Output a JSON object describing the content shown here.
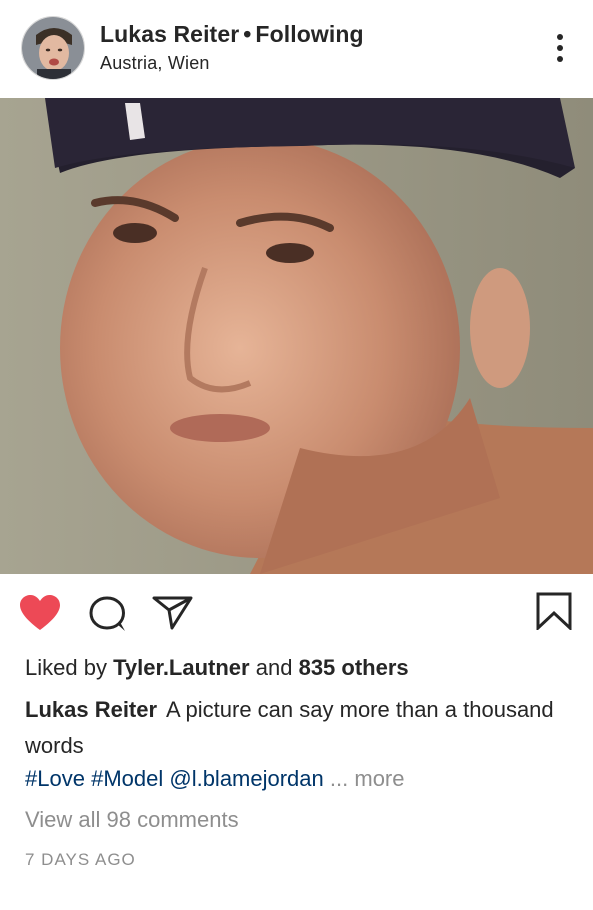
{
  "post": {
    "username": "Lukas Reiter",
    "separator": "•",
    "follow_status": "Following",
    "location": "Austria, Wien",
    "liked_by_prefix": "Liked by",
    "liked_by_user": "Tyler.Lautner",
    "liked_by_and": "and",
    "liked_by_others": "835 others",
    "caption_user": "Lukas Reiter",
    "caption_text": "A picture can say more than a thousand words",
    "tags": [
      "#Love",
      "#Model",
      "@l.blamejordan"
    ],
    "ellipsis": "...",
    "more_label": "more",
    "view_comments": "View all 98 comments",
    "timestamp": "7 DAYS AGO"
  },
  "icons": {
    "options": "three-dots-vertical-icon",
    "like": "heart-filled-icon",
    "comment": "speech-bubble-icon",
    "share": "paper-plane-icon",
    "save": "bookmark-icon"
  },
  "colors": {
    "liked_heart": "#ed4956",
    "text": "#262626",
    "hashtag": "#003569",
    "muted": "#8e8e8e"
  }
}
